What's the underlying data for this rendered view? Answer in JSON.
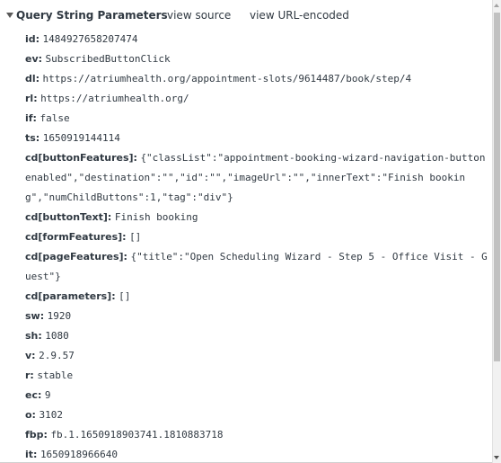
{
  "header": {
    "title": "Query String Parameters",
    "view_source": "view source",
    "view_url_encoded": "view URL-encoded"
  },
  "params": [
    {
      "key": "id:",
      "value": "1484927658207474"
    },
    {
      "key": "ev:",
      "value": "SubscribedButtonClick"
    },
    {
      "key": "dl:",
      "value": "https://atriumhealth.org/appointment-slots/9614487/book/step/4"
    },
    {
      "key": "rl:",
      "value": "https://atriumhealth.org/"
    },
    {
      "key": "if:",
      "value": "false"
    },
    {
      "key": "ts:",
      "value": "1650919144114"
    },
    {
      "key": "cd[buttonFeatures]:",
      "value": "{\"classList\":\"appointment-booking-wizard-navigation-button enabled\",\"destination\":\"\",\"id\":\"\",\"imageUrl\":\"\",\"innerText\":\"Finish booking\",\"numChildButtons\":1,\"tag\":\"div\"}"
    },
    {
      "key": "cd[buttonText]:",
      "value": "Finish booking"
    },
    {
      "key": "cd[formFeatures]:",
      "value": "[]"
    },
    {
      "key": "cd[pageFeatures]:",
      "value": "{\"title\":\"Open Scheduling Wizard - Step 5 - Office Visit - Guest\"}"
    },
    {
      "key": "cd[parameters]:",
      "value": "[]"
    },
    {
      "key": "sw:",
      "value": "1920"
    },
    {
      "key": "sh:",
      "value": "1080"
    },
    {
      "key": "v:",
      "value": "2.9.57"
    },
    {
      "key": "r:",
      "value": "stable"
    },
    {
      "key": "ec:",
      "value": "9"
    },
    {
      "key": "o:",
      "value": "3102"
    },
    {
      "key": "fbp:",
      "value": "fb.1.1650918903741.1810883718"
    },
    {
      "key": "it:",
      "value": "1650918966640"
    }
  ]
}
